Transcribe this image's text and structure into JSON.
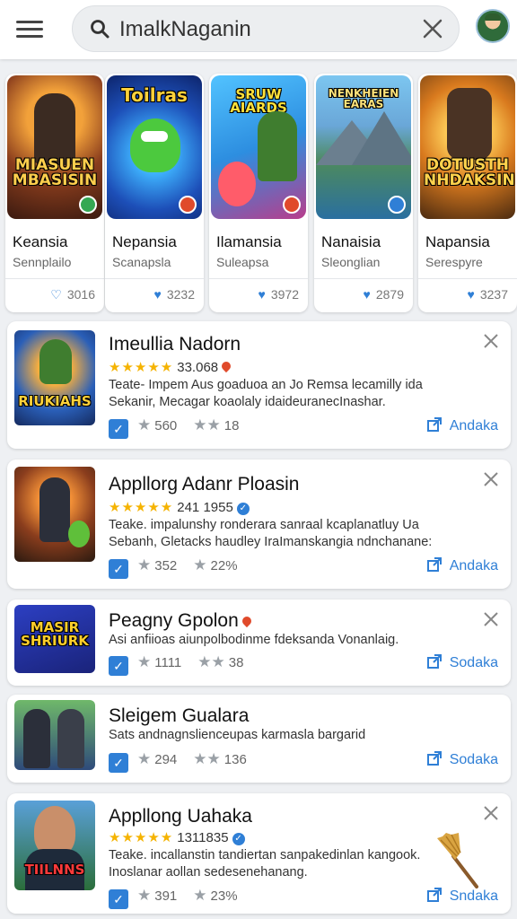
{
  "header": {
    "search_query": "ImalkNaganin",
    "icons": {
      "menu": "hamburger-menu-icon",
      "search": "search-icon",
      "clear": "close-icon",
      "profile": "avatar"
    }
  },
  "featured": [
    {
      "art_text": "MIASUEN MBASISIN",
      "title": "Keansia",
      "subtitle": "Sennplailo",
      "likes": "3016",
      "heart_icon": "shield-icon"
    },
    {
      "art_text": "Toilras",
      "title": "Nepansia",
      "subtitle": "Scanapsla",
      "likes": "3232",
      "heart_icon": "heart-icon"
    },
    {
      "art_text": "SRUW AIARDS",
      "title": "Ilamansia",
      "subtitle": "Suleapsa",
      "likes": "3972",
      "heart_icon": "heart-icon"
    },
    {
      "art_text": "NENKHEIEN EARAS",
      "title": "Nanaisia",
      "subtitle": "Sleonglian",
      "likes": "2879",
      "heart_icon": "heart-icon"
    },
    {
      "art_text": "DOTUSTH NHDAKSIN",
      "title": "Napansia",
      "subtitle": "Serespyre",
      "likes": "3237",
      "heart_icon": "heart-icon"
    }
  ],
  "list": [
    {
      "title": "Imeullia Nadorn",
      "stars": "★★★★★",
      "rating_text": "33.068",
      "desc": "Teate- Impem Aus goaduoa an Jo Remsa lecamilly ida Sekanir, Mecagar koaolaly idaideuranecInashar.",
      "meta_a": "560",
      "meta_b": "18",
      "action": "Andaka",
      "thumb_text": "RIUKIAHS"
    },
    {
      "title": "Appllorg Adanr Ploasin",
      "stars": "★★★★★",
      "rating_text": "241 1955",
      "desc": "Teake. impalunshy ronderara sanraal kcaplanatluy Ua Sebanh, Gletacks haudley IraImanskangia ndnchanane:",
      "meta_a": "352",
      "meta_b": "22%",
      "action": "Andaka",
      "thumb_text": ""
    },
    {
      "title": "Peagny Gpolon",
      "stars": "",
      "rating_text": "",
      "desc": "Asi anfiioas aiunpolbodinme fdeksanda Vonanlaig.",
      "meta_a": "1111",
      "meta_b": "38",
      "action": "Sodaka",
      "thumb_text": "MASIR SHRIURK"
    },
    {
      "title": "Sleigem Gualara",
      "stars": "",
      "rating_text": "",
      "desc": "Sats andnagnslienceupas karmasla bargarid",
      "meta_a": "294",
      "meta_b": "136",
      "action": "Sodaka",
      "thumb_text": ""
    },
    {
      "title": "Appllong Uahaka",
      "stars": "★★★★★",
      "rating_text": "1311835",
      "desc": "Teake. incallanstin tandiertan sanpakedinlan kangook. Inoslanar aollan sedesenehanang.",
      "meta_a": "391",
      "meta_b": "23%",
      "action": "Sndaka",
      "thumb_text": "TIILNNS"
    }
  ],
  "colors": {
    "accent": "#2f7fd6",
    "star": "#f5b301",
    "background": "#eef0f3"
  }
}
